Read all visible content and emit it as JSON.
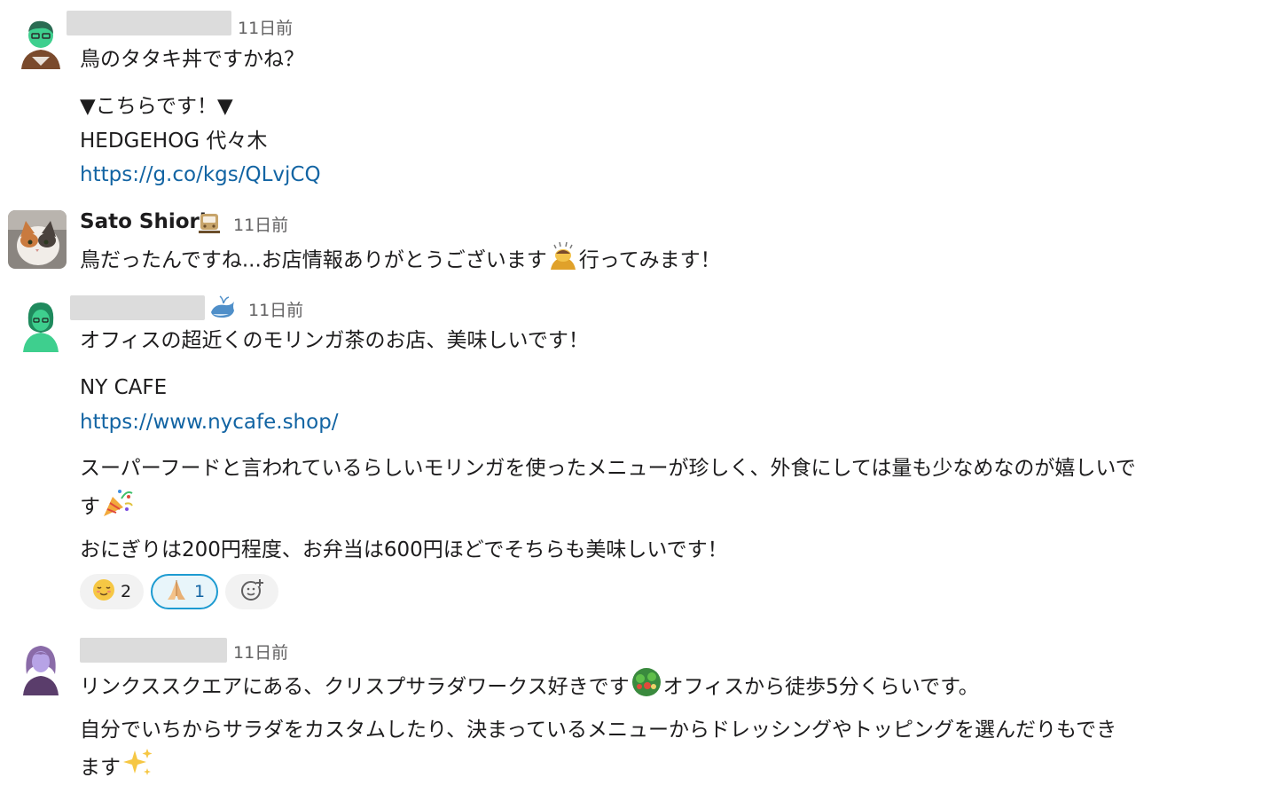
{
  "messages": [
    {
      "name_hidden": true,
      "time": "11日前",
      "lines": [
        "鳥のタタキ丼ですかね？",
        "▼こちらです！▼",
        "HEDGEHOG 代々木"
      ],
      "link": "https://g.co/kgs/QLvjCQ"
    },
    {
      "name": "Sato Shiori",
      "time": "11日前",
      "status_icon": "train-icon",
      "text_before": "鳥だったんですね...お店情報ありがとうございます",
      "emoji": "person-bowing-icon",
      "text_after": "行ってみます！"
    },
    {
      "name_hidden": true,
      "status_icon": "whale-icon",
      "time": "11日前",
      "line1": "オフィスの超近くのモリンガ茶のお店、美味しいです！",
      "shop_name": "NY CAFE",
      "link": "https://www.nycafe.shop/",
      "line3a": "スーパーフードと言われているらしいモリンガを使ったメニューが珍しく、外食にしては量も少なめなのが嬉しいで",
      "line3b": "す",
      "emoji": "party-popper-icon",
      "line4": "おにぎりは200円程度、お弁当は600円ほどでそちらも美味しいです！",
      "reactions": [
        {
          "icon": "relieved-face-icon",
          "count": "2",
          "active": false
        },
        {
          "icon": "folded-hands-icon",
          "count": "1",
          "active": true
        },
        {
          "icon": "add-reaction-icon",
          "count": "",
          "active": false
        }
      ]
    },
    {
      "name_hidden": true,
      "time": "11日前",
      "line1a": "リンクススクエアにある、クリスプサラダワークス好きです",
      "emoji1": "salad-icon",
      "line1b": "オフィスから徒歩5分くらいです。",
      "line2a": "自分でいちからサラダをカスタムしたり、決まっているメニューからドレッシングやトッピングを選んだりもでき",
      "line2b": "ます",
      "emoji2": "sparkles-icon"
    }
  ]
}
